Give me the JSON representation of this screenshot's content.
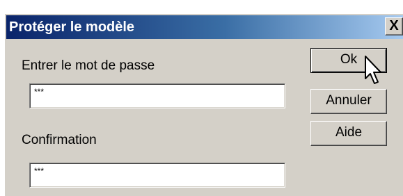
{
  "dialog": {
    "title": "Protéger le modèle",
    "close_label": "X"
  },
  "form": {
    "password_label": "Entrer le mot de passe",
    "password_value": "***",
    "confirm_label": "Confirmation",
    "confirm_value": "***"
  },
  "buttons": {
    "ok_label": "Ok",
    "cancel_label": "Annuler",
    "help_label": "Aide"
  },
  "cursor": {
    "icon": "mouse-pointer-icon"
  }
}
